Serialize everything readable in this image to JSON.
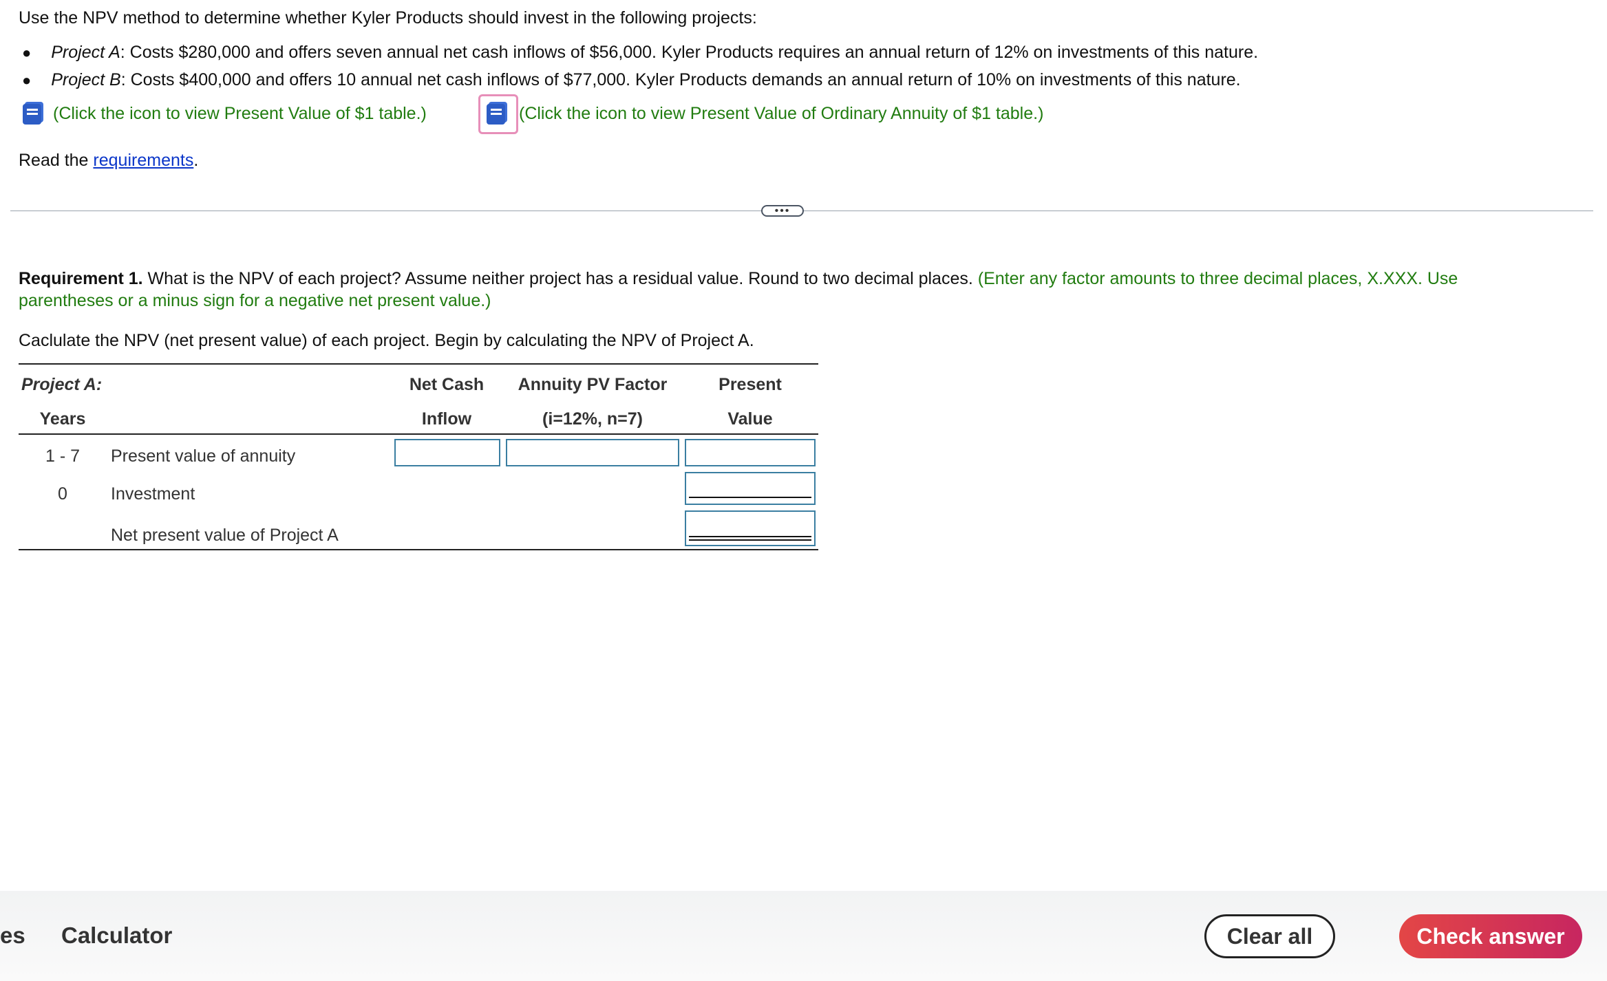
{
  "intro": "Use the NPV method to determine whether Kyler Products should invest in the following projects:",
  "bullets": [
    {
      "label": "Project A",
      "text": ": Costs $280,000 and offers seven annual net cash inflows of $56,000. Kyler Products requires an annual return of 12% on investments of this nature."
    },
    {
      "label": "Project B",
      "text": ": Costs $400,000 and offers 10 annual net cash inflows of $77,000. Kyler Products demands an annual return of 10% on investments of this nature."
    }
  ],
  "links": {
    "pv_table": "(Click the icon to view Present Value of $1 table.)",
    "annuity_table": "(Click the icon to view Present Value of Ordinary Annuity of $1 table.)"
  },
  "read": {
    "prefix": "Read the ",
    "link": "requirements",
    "suffix": "."
  },
  "divider_label": "•••",
  "requirement": {
    "label": "Requirement 1.",
    "text": " What is the NPV of each project? Assume neither project has a residual value. Round to two decimal places.",
    "hint_line1": "(Enter any factor amounts to three decimal places, X.XXX. Use",
    "hint_line2": "parentheses or a minus sign for a negative net present value.)"
  },
  "instruction": "Caclulate the NPV (net present value) of each project. Begin by calculating the NPV of Project A.",
  "table": {
    "title": "Project A:",
    "col_years": "Years",
    "col_ncf_1": "Net Cash",
    "col_ncf_2": "Inflow",
    "col_factor_1": "Annuity PV Factor",
    "col_factor_2": "(i=12%, n=7)",
    "col_pv_1": "Present",
    "col_pv_2": "Value",
    "rows": [
      {
        "years": "1 - 7",
        "label": "Present value of annuity"
      },
      {
        "years": "0",
        "label": "Investment"
      },
      {
        "years": "",
        "label": "Net present value of Project A"
      }
    ]
  },
  "footer": {
    "left_partial": "es",
    "calculator": "Calculator",
    "clear_all": "Clear all",
    "check_answer": "Check answer"
  },
  "colors": {
    "green": "#217c10",
    "link": "#0b36c9",
    "input_border": "#3a7ea1",
    "check_button": "#d6354f"
  }
}
